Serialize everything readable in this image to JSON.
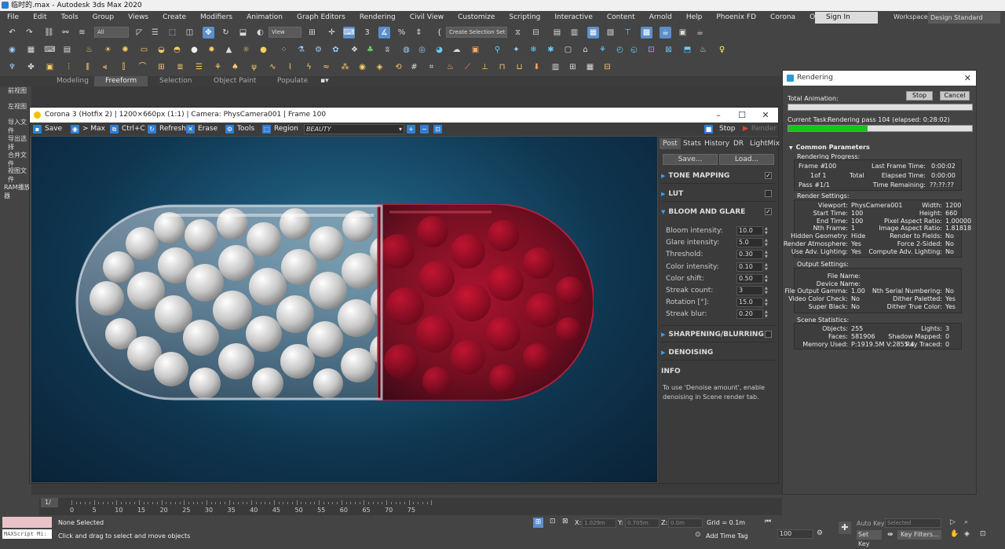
{
  "window": {
    "title": "临时的.max - Autodesk 3ds Max 2020"
  },
  "menu": [
    "File",
    "Edit",
    "Tools",
    "Group",
    "Views",
    "Create",
    "Modifiers",
    "Animation",
    "Graph Editors",
    "Rendering",
    "Civil View",
    "Customize",
    "Scripting",
    "Interactive",
    "Content",
    "Arnold",
    "Help",
    "Phoenix FD",
    "Corona",
    "Ornatrix"
  ],
  "account": {
    "signin": "Sign In",
    "workspaces_label": "Workspaces:",
    "workspace": "Design Standard"
  },
  "toolbar": {
    "filter": "All",
    "view": "View",
    "selection_set": "Create Selection Set"
  },
  "ribbon": {
    "tabs": [
      "Modeling",
      "Freeform",
      "Selection",
      "Object Paint",
      "Populate"
    ]
  },
  "left_panel": {
    "items": [
      "前视图",
      "左视图",
      "导入文件",
      "导出选择",
      "合并文件",
      "视图文件",
      "RAM播放器"
    ]
  },
  "vfb": {
    "title": "Corona 3 (Hotfix 2) | 1200×660px (1:1) | Camera: PhysCamera001 | Frame 100",
    "buttons": {
      "save": "Save",
      "to_max": "> Max",
      "copy": "Ctrl+C",
      "refresh": "Refresh",
      "erase": "Erase",
      "tools": "Tools",
      "region": "Region",
      "stop": "Stop",
      "render": "Render"
    },
    "channel": "BEAUTY",
    "tabs": [
      "Post",
      "Stats",
      "History",
      "DR",
      "LightMix"
    ],
    "save_btn": "Save...",
    "load_btn": "Load...",
    "sections": {
      "tone_mapping": {
        "label": "TONE MAPPING",
        "checked": true
      },
      "lut": {
        "label": "LUT",
        "checked": false
      },
      "bloom": {
        "label": "BLOOM AND GLARE",
        "checked": true
      },
      "sharpen": {
        "label": "SHARPENING/BLURRING",
        "checked": false
      },
      "denoise": {
        "label": "DENOISING"
      }
    },
    "bloom_params": [
      {
        "label": "Bloom intensity:",
        "value": "10.0"
      },
      {
        "label": "Glare intensity:",
        "value": "5.0"
      },
      {
        "label": "Threshold:",
        "value": "0.30"
      },
      {
        "label": "Color intensity:",
        "value": "0.10"
      },
      {
        "label": "Color shift:",
        "value": "0.50"
      },
      {
        "label": "Streak count:",
        "value": "3"
      },
      {
        "label": "Rotation [°]:",
        "value": "15.0"
      },
      {
        "label": "Streak blur:",
        "value": "0.20"
      }
    ],
    "info_title": "INFO",
    "info_text_1": "To use 'Denoise amount', enable",
    "info_text_2": "denoising in Scene render tab."
  },
  "rendering": {
    "title": "Rendering",
    "total_animation": "Total Animation:",
    "stop": "Stop",
    "cancel": "Cancel",
    "current_task_label": "Current Task:",
    "current_task": "Rendering pass 104 (elapsed: 0:28:02)",
    "total_progress": 0,
    "task_progress": 0.43,
    "common_params": "Common Parameters",
    "progress": {
      "heading": "Rendering Progress:",
      "frame_label": "Frame #",
      "frame": "100",
      "of_label": "1of 1",
      "total_label": "Total",
      "pass_label": "Pass #",
      "pass": "1/1",
      "last_frame_time_label": "Last Frame Time:",
      "last_frame_time": "0:00:02",
      "elapsed_label": "Elapsed Time:",
      "elapsed": "0:00:00",
      "remaining_label": "Time Remaining:",
      "remaining": "??:??:??"
    },
    "render_settings": {
      "heading": "Render Settings:",
      "left": [
        [
          "Viewport:",
          "PhysCamera001"
        ],
        [
          "Start Time:",
          "100"
        ],
        [
          "End Time:",
          "100"
        ],
        [
          "Nth Frame:",
          "1"
        ],
        [
          "Hidden Geometry:",
          "Hide"
        ],
        [
          "Render Atmosphere:",
          "Yes"
        ],
        [
          "Use Adv. Lighting:",
          "Yes"
        ]
      ],
      "right": [
        [
          "Width:",
          "1200"
        ],
        [
          "Height:",
          "660"
        ],
        [
          "Pixel Aspect Ratio:",
          "1.00000"
        ],
        [
          "Image Aspect Ratio:",
          "1.81818"
        ],
        [
          "Render to Fields:",
          "No"
        ],
        [
          "Force 2-Sided:",
          "No"
        ],
        [
          "Compute Adv. Lighting:",
          "No"
        ]
      ]
    },
    "output_settings": {
      "heading": "Output Settings:",
      "file_name_label": "File Name:",
      "device_name_label": "Device Name:",
      "left": [
        [
          "File Output Gamma:",
          "1.00"
        ],
        [
          "Video Color Check:",
          "No"
        ],
        [
          "Super Black:",
          "No"
        ]
      ],
      "right": [
        [
          "Nth Serial Numbering:",
          "No"
        ],
        [
          "Dither Paletted:",
          "Yes"
        ],
        [
          "Dither True Color:",
          "Yes"
        ]
      ]
    },
    "scene_stats": {
      "heading": "Scene Statistics:",
      "left": [
        [
          "Objects:",
          "255"
        ],
        [
          "Faces:",
          "581906"
        ],
        [
          "Memory Used:",
          "P:1919.5M V:2855.4"
        ]
      ],
      "right": [
        [
          "Lights:",
          "3"
        ],
        [
          "Shadow Mapped:",
          "0"
        ],
        [
          "Ray Traced:",
          "0"
        ]
      ]
    }
  },
  "timeline": {
    "frame_display": "1/",
    "ticks": [
      "0",
      "5",
      "10",
      "15",
      "20",
      "25",
      "30",
      "35",
      "40",
      "45",
      "50",
      "55",
      "60",
      "65",
      "70",
      "75"
    ]
  },
  "status": {
    "maxscript": "MAXScript Mi:",
    "selected": "None Selected",
    "prompt": "Click and drag to select and move objects",
    "x_label": "X:",
    "x": "1.029m",
    "y_label": "Y:",
    "y": "0.705m",
    "z_label": "Z:",
    "z": "0.0m",
    "grid": "Grid = 0.1m",
    "add_time_tag": "Add Time Tag",
    "frame": "100",
    "auto_key": "Auto Key",
    "set_key": "Set Key",
    "selected_dd": "Selected",
    "key_filters": "Key Filters..."
  }
}
